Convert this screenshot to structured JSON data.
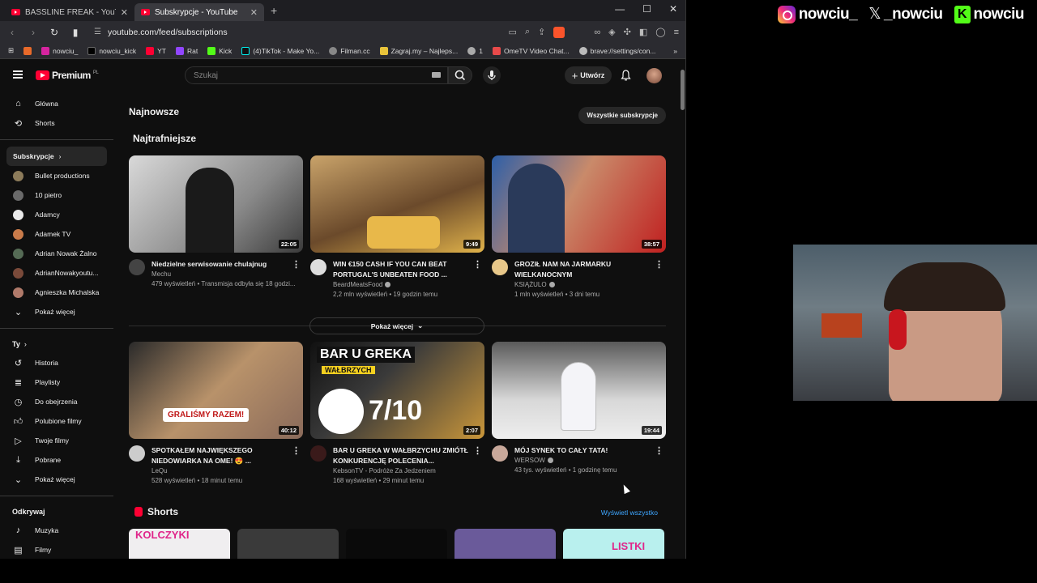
{
  "browser": {
    "tabs": [
      {
        "title": "BASSLINE FREAK - YouTube",
        "active": false
      },
      {
        "title": "Subskrypcje - YouTube",
        "active": true
      }
    ],
    "url": "youtube.com/feed/subscriptions",
    "bookmarks": [
      "nowciu_",
      "nowciu_kick",
      "YT",
      "Rat",
      "Kick",
      "(4)TikTok - Make Yo...",
      "Filman.cc",
      "Zagraj.my – Najleps...",
      "1",
      "OmeTV Video Chat...",
      "brave://settings/con..."
    ]
  },
  "youtube": {
    "logo_text": "Premium",
    "logo_region": "PL",
    "search_placeholder": "Szukaj",
    "create_label": "Utwórz",
    "sidebar": {
      "main": [
        {
          "label": "Główna",
          "icon": "home-icon"
        },
        {
          "label": "Shorts",
          "icon": "shorts-icon"
        }
      ],
      "subs_header": "Subskrypcje",
      "channels": [
        {
          "label": "Bullet productions",
          "color": "#8c7b5a"
        },
        {
          "label": "10 pietro",
          "color": "#6a6a6a"
        },
        {
          "label": "Adamcy",
          "color": "#eaeaea"
        },
        {
          "label": "Adamek TV",
          "color": "#c97b4a"
        },
        {
          "label": "Adrian Nowak Żalno",
          "color": "#556b55"
        },
        {
          "label": "AdrianNowakyoutu...",
          "color": "#7a4a3a"
        },
        {
          "label": "Agnieszka Michalska",
          "color": "#b07a6a"
        }
      ],
      "show_more_1": "Pokaż więcej",
      "you_header": "Ty",
      "you_items": [
        {
          "label": "Historia",
          "icon": "history-icon"
        },
        {
          "label": "Playlisty",
          "icon": "playlist-icon"
        },
        {
          "label": "Do obejrzenia",
          "icon": "clock-icon"
        },
        {
          "label": "Polubione filmy",
          "icon": "like-icon"
        },
        {
          "label": "Twoje filmy",
          "icon": "video-icon"
        },
        {
          "label": "Pobrane",
          "icon": "download-icon"
        }
      ],
      "show_more_2": "Pokaż więcej",
      "explore_header": "Odkrywaj",
      "explore_items": [
        {
          "label": "Muzyka",
          "icon": "music-icon"
        },
        {
          "label": "Filmy",
          "icon": "film-icon"
        }
      ]
    },
    "main": {
      "section_title": "Najnowsze",
      "all_subs_label": "Wszystkie subskrypcje",
      "subsection_title": "Najtrafniejsze",
      "row1": [
        {
          "title": "Niedzielne serwisowanie chulajnug",
          "channel": "Mechu",
          "verified": false,
          "stats": "479 wyświetleń • Transmisja odbyła się 18 godzi...",
          "duration": "22:05",
          "thumb": "linear-gradient(135deg,#d9d9d9,#8a8a8a 60%,#3b3b3b)",
          "avatar": "#444"
        },
        {
          "title": "WIN €150 CASH IF YOU CAN BEAT PORTUGAL'S UNBEATEN FOOD ...",
          "channel": "BeardMeatsFood",
          "verified": true,
          "stats": "2,2 mln wyświetleń • 19 godzin temu",
          "duration": "9:49",
          "thumb": "linear-gradient(160deg,#c9a36a,#6b4a2b 55%,#e0b24a)",
          "avatar": "#ddd"
        },
        {
          "title": "GROZIŁ NAM NA JARMARKU WIELKANOCNYM",
          "channel": "KSIĄŻULO",
          "verified": true,
          "stats": "1 mln wyświetleń • 3 dni temu",
          "duration": "38:57",
          "thumb": "linear-gradient(120deg,#2d5fa8,#c98a6a 45%,#c02020)",
          "avatar": "#e8c88a"
        }
      ],
      "show_more_label": "Pokaż więcej",
      "row2": [
        {
          "title": "SPOTKAŁEM NAJWIĘKSZEGO NIEDOWIARKA NA OME! 😍 ...",
          "channel": "LeQu",
          "verified": false,
          "stats": "528 wyświetleń • 18 minut temu",
          "duration": "40:12",
          "thumb": "linear-gradient(135deg,#2a2a2a,#b8926a 50%,#c01818)",
          "avatar": "#ccc"
        },
        {
          "title": "BAR U GREKA W WAŁBRZYCHU ZMIÓTŁ KONKURENCJĘ POLECENIA...",
          "channel": "KebsonTV - Podróże Za Jedzeniem",
          "verified": false,
          "stats": "168 wyświetleń • 29 minut temu",
          "duration": "2:07",
          "thumb": "linear-gradient(135deg,#111,#3a3a3a 40%,#c9963a)",
          "avatar": "#3a1a1a"
        },
        {
          "title": "MÓJ SYNEK TO CAŁY TATA!",
          "channel": "WERSOW",
          "verified": true,
          "stats": "43 tys. wyświetleń • 1 godzinę temu",
          "duration": "19:44",
          "thumb": "linear-gradient(180deg,#5a5a5a,#d8d8d8 60%,#eee)",
          "avatar": "#c8a89a"
        }
      ],
      "thumb_texts": {
        "t1": "BAR U GREKA",
        "t2": "WAŁBRZYCH",
        "t3": "7/10",
        "t4": "GRALIŚMY RAZEM!"
      },
      "shorts_title": "Shorts",
      "view_all_label": "Wyświetl wszystko",
      "shorts": [
        {
          "text": "KOLCZYKI",
          "bg": "#f0eef0",
          "fg": "#e0258a"
        },
        {
          "text": "",
          "bg": "#3a3a3a",
          "fg": "#fff"
        },
        {
          "text": "",
          "bg": "#0a0a0a",
          "fg": "#fff"
        },
        {
          "text": "",
          "bg": "#6a5a9a",
          "fg": "#fff"
        },
        {
          "text": "LISTKI",
          "bg": "#b9f0ee",
          "fg": "#e0258a"
        }
      ]
    }
  },
  "overlay": {
    "instagram": "nowciu_",
    "x": "_nowciu",
    "kick": "nowciu"
  }
}
